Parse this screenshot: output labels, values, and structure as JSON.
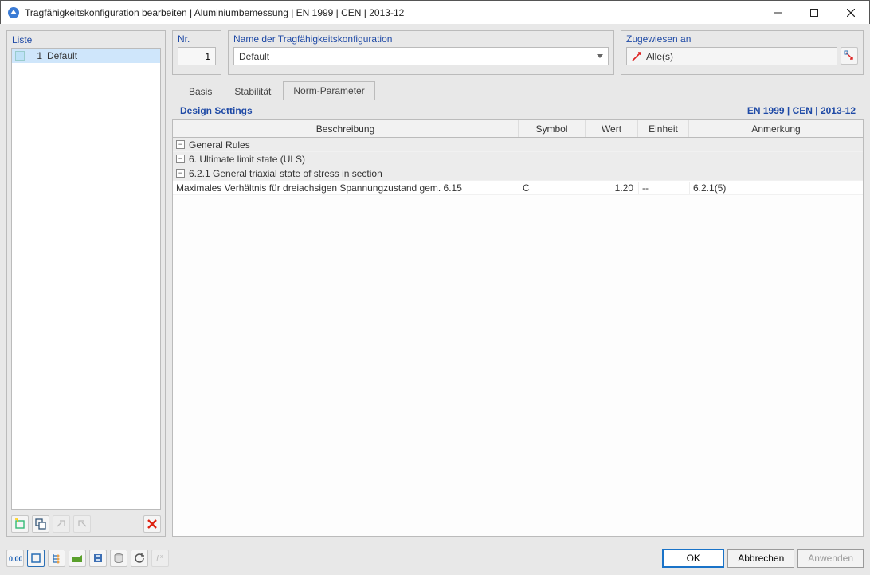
{
  "window": {
    "title": "Tragfähigkeitskonfiguration bearbeiten | Aluminiumbemessung | EN 1999 | CEN | 2013-12"
  },
  "left": {
    "heading": "Liste",
    "items": [
      {
        "num": "1",
        "name": "Default",
        "selected": true
      }
    ]
  },
  "nr": {
    "label": "Nr.",
    "value": "1"
  },
  "name": {
    "label": "Name der Tragfähigkeitskonfiguration",
    "value": "Default"
  },
  "assign": {
    "label": "Zugewiesen an",
    "value": "Alle(s)"
  },
  "tabs": {
    "basis": "Basis",
    "stabilitaet": "Stabilität",
    "norm": "Norm-Parameter",
    "active": "norm"
  },
  "design": {
    "title": "Design Settings",
    "norm": "EN 1999 | CEN | 2013-12"
  },
  "grid": {
    "headers": {
      "desc": "Beschreibung",
      "sym": "Symbol",
      "val": "Wert",
      "unit": "Einheit",
      "rem": "Anmerkung"
    },
    "group": "General Rules",
    "sub": "6. Ultimate limit state (ULS)",
    "sub2": "6.2.1 General triaxial state of stress in section",
    "row": {
      "desc": "Maximales Verhältnis für dreiachsigen Spannungzustand gem. 6.15",
      "sym": "C",
      "val": "1.20",
      "unit": "--",
      "rem": "6.2.1(5)"
    }
  },
  "buttons": {
    "ok": "OK",
    "cancel": "Abbrechen",
    "apply": "Anwenden"
  }
}
